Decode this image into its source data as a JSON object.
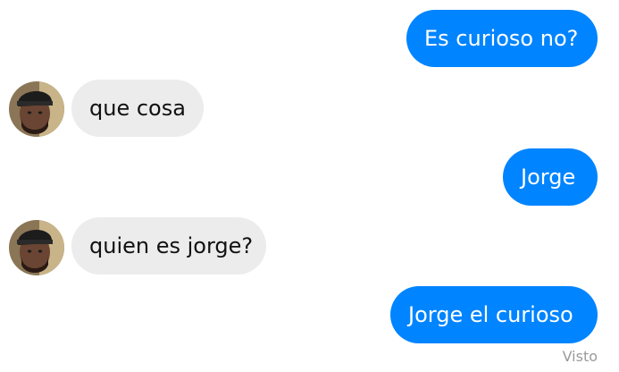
{
  "conversation": {
    "messages": [
      {
        "sender": "me",
        "text": "Es curioso no?"
      },
      {
        "sender": "other",
        "text": "que cosa"
      },
      {
        "sender": "me",
        "text": "Jorge"
      },
      {
        "sender": "other",
        "text": "quien es jorge?"
      },
      {
        "sender": "me",
        "text": "Jorge el curioso"
      }
    ],
    "seen_label": "Visto"
  },
  "colors": {
    "outgoing_bubble": "#0084ff",
    "incoming_bubble": "#ececec",
    "seen_text": "#9a9a9a"
  },
  "icons": {
    "avatar": "profile-photo-avatar"
  }
}
